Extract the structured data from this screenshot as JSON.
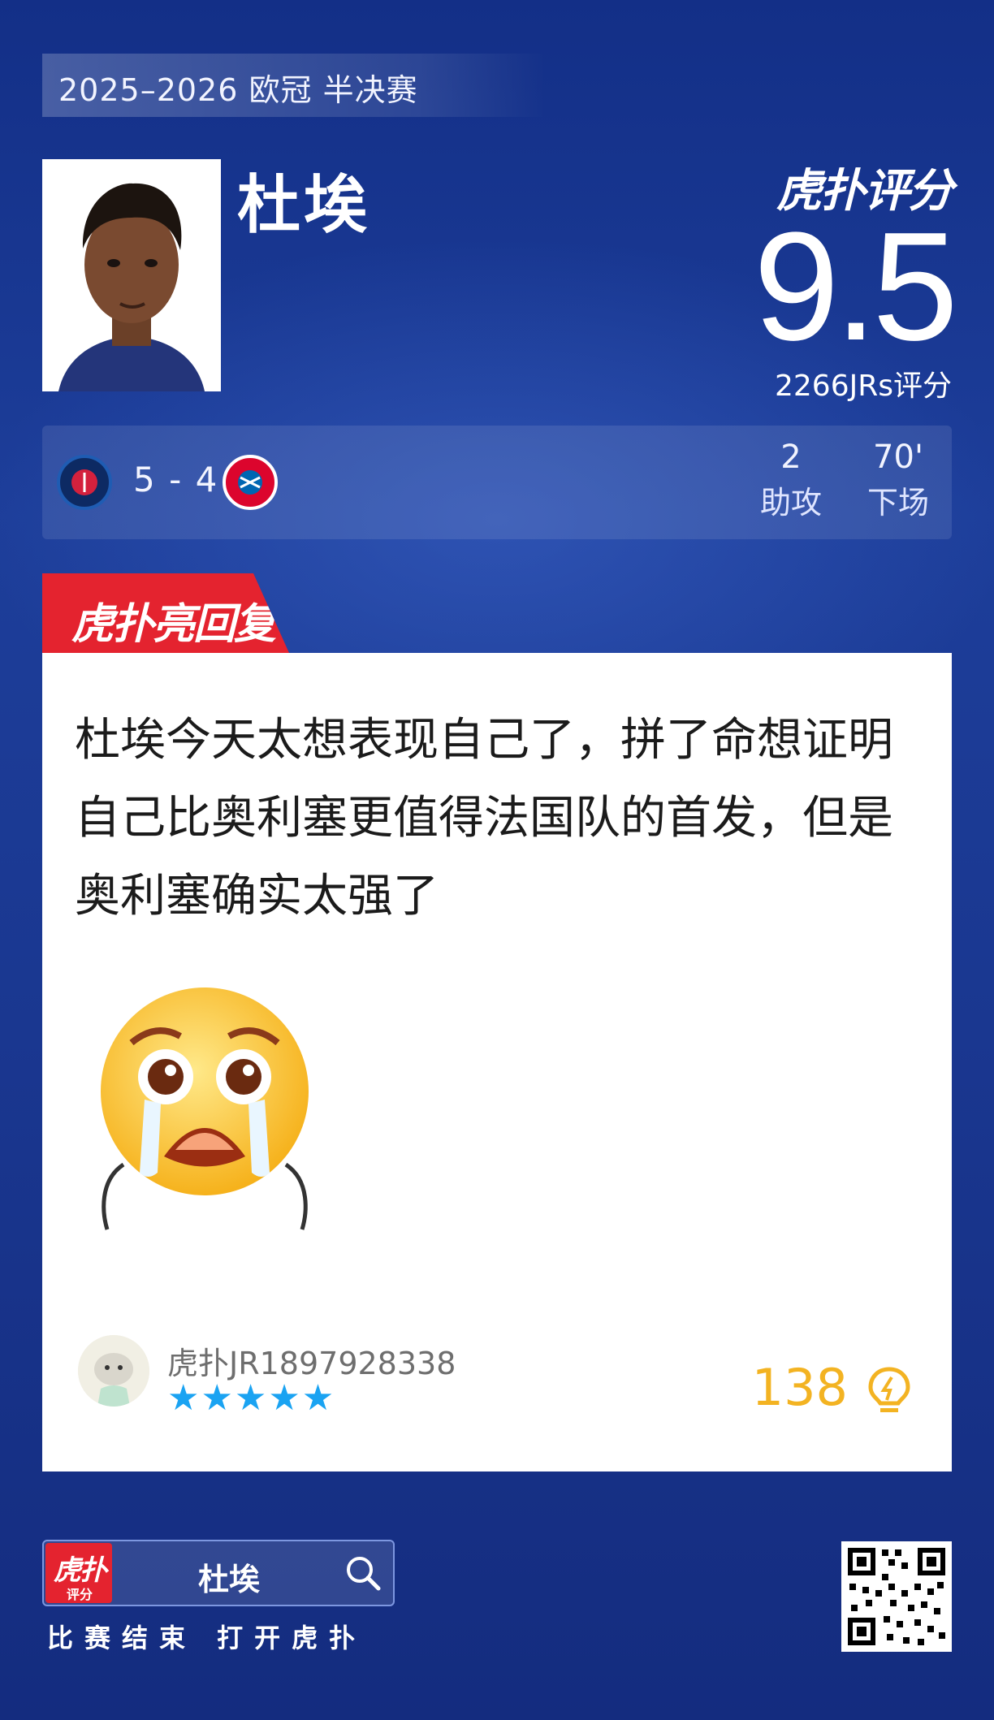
{
  "header": {
    "competition": "2025–2026 欧冠 半决赛"
  },
  "player": {
    "name": "杜埃"
  },
  "rating": {
    "brand": "虎扑评分",
    "score": "9.5",
    "count_text": "2266JRs评分"
  },
  "match": {
    "score": "5 - 4",
    "home_team": "Paris Saint-Germain",
    "away_team": "FC Bayern München",
    "stats": [
      {
        "value": "2",
        "label": "助攻"
      },
      {
        "value": "70'",
        "label": "下场"
      }
    ]
  },
  "reply": {
    "tag": "虎扑亮回复",
    "comment": "杜埃今天太想表现自己了，拼了命想证明自己比奥利塞更值得法国队的首发，但是奥利塞确实太强了",
    "username": "虎扑JR1897928338",
    "stars": "★★★★★",
    "likes": "138"
  },
  "footer": {
    "app_icon_main": "虎扑",
    "app_icon_sub": "评分",
    "search_term": "杜埃",
    "caption": "比赛结束 打开虎扑"
  },
  "colors": {
    "background": "#1a3790",
    "accent_red": "#e4232f",
    "like_gold": "#f3b322",
    "star_blue": "#1aa3f2"
  }
}
